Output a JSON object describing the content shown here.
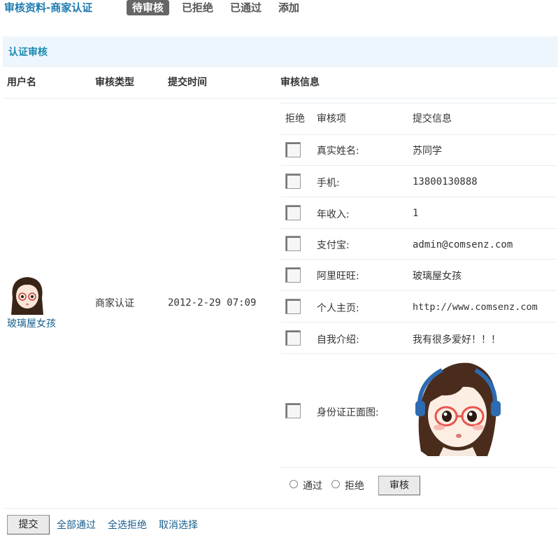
{
  "header": {
    "title": "审核资料-商家认证",
    "tabs": [
      {
        "label": "待审核",
        "active": true
      },
      {
        "label": "已拒绝",
        "active": false
      },
      {
        "label": "已通过",
        "active": false
      },
      {
        "label": "添加",
        "active": false
      }
    ]
  },
  "section": {
    "title": "认证审核"
  },
  "table": {
    "headers": [
      "用户名",
      "审核类型",
      "提交时间",
      "审核信息"
    ],
    "row": {
      "username": "玻璃屋女孩",
      "type": "商家认证",
      "time": "2012-2-29 07:09"
    }
  },
  "review": {
    "headers": [
      "拒绝",
      "审核项",
      "提交信息"
    ],
    "items": [
      {
        "label": "真实姓名:",
        "value": "苏同学"
      },
      {
        "label": "手机:",
        "value": "13800130888"
      },
      {
        "label": "年收入:",
        "value": "1"
      },
      {
        "label": "支付宝:",
        "value": "admin@comsenz.com"
      },
      {
        "label": "阿里旺旺:",
        "value": "玻璃屋女孩"
      },
      {
        "label": "个人主页:",
        "value": "http://www.comsenz.com"
      },
      {
        "label": "自我介绍:",
        "value": "我有很多爱好！！！"
      },
      {
        "label": "身份证正面图:",
        "value": ""
      }
    ],
    "pass_label": "通过",
    "reject_label": "拒绝",
    "review_button": "审核"
  },
  "footer": {
    "submit": "提交",
    "links": [
      "全部通过",
      "全选拒绝",
      "取消选择"
    ]
  },
  "colors": {
    "title": "#1d7ab0",
    "link": "#1a5f8e",
    "header_bg": "#eef6fd",
    "active_tab": "#666666"
  }
}
